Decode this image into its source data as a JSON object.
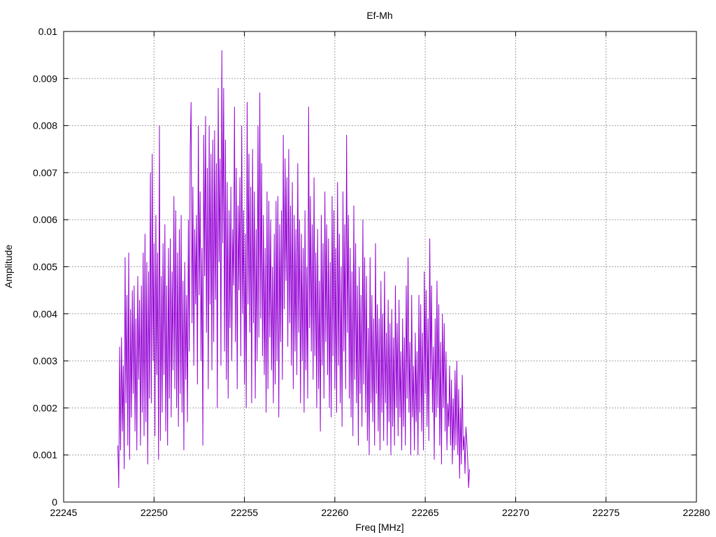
{
  "chart_data": {
    "type": "line",
    "title": "Ef-Mh",
    "xlabel": "Freq [MHz]",
    "ylabel": "Amplitude",
    "xlim": [
      22245,
      22280
    ],
    "ylim": [
      0,
      0.01
    ],
    "x_ticks": [
      22245,
      22250,
      22255,
      22260,
      22265,
      22270,
      22275,
      22280
    ],
    "x_tick_labels": [
      "22245",
      "22250",
      "22255",
      "22260",
      "22265",
      "22270",
      "22275",
      "22280"
    ],
    "y_ticks": [
      0,
      0.001,
      0.002,
      0.003,
      0.004,
      0.005,
      0.006,
      0.007,
      0.008,
      0.009,
      0.01
    ],
    "y_tick_labels": [
      "0",
      "0.001",
      "0.002",
      "0.003",
      "0.004",
      "0.005",
      "0.006",
      "0.007",
      "0.008",
      "0.009",
      "0.01"
    ],
    "grid": true,
    "series": [
      {
        "color": "#9400d3",
        "x_start": 22248.0,
        "x_step": 0.05,
        "values": [
          0.0012,
          0.0003,
          0.0033,
          0.0011,
          0.0035,
          0.0015,
          0.0029,
          0.0007,
          0.0052,
          0.0021,
          0.0044,
          0.0012,
          0.0053,
          0.0009,
          0.0041,
          0.0018,
          0.0045,
          0.0023,
          0.0046,
          0.0015,
          0.0039,
          0.0011,
          0.0048,
          0.0026,
          0.0043,
          0.0012,
          0.0046,
          0.0019,
          0.0053,
          0.0014,
          0.0057,
          0.0017,
          0.0051,
          0.0008,
          0.0049,
          0.0022,
          0.007,
          0.0021,
          0.0074,
          0.003,
          0.0055,
          0.0014,
          0.0061,
          0.0027,
          0.0053,
          0.0009,
          0.008,
          0.0013,
          0.0048,
          0.0019,
          0.0055,
          0.0027,
          0.0059,
          0.0015,
          0.0046,
          0.0012,
          0.0054,
          0.0022,
          0.0056,
          0.0018,
          0.0049,
          0.0028,
          0.0065,
          0.0024,
          0.0062,
          0.002,
          0.0053,
          0.0016,
          0.0058,
          0.0023,
          0.0061,
          0.0019,
          0.0047,
          0.0011,
          0.0051,
          0.0026,
          0.0044,
          0.0017,
          0.006,
          0.0032,
          0.0075,
          0.0085,
          0.0038,
          0.0067,
          0.0029,
          0.0058,
          0.0042,
          0.0061,
          0.0025,
          0.008,
          0.0044,
          0.0066,
          0.003,
          0.0054,
          0.0012,
          0.0078,
          0.0048,
          0.0082,
          0.0036,
          0.0071,
          0.0024,
          0.008,
          0.0042,
          0.0074,
          0.0028,
          0.0077,
          0.0034,
          0.0079,
          0.0043,
          0.0072,
          0.002,
          0.0088,
          0.0051,
          0.0073,
          0.0029,
          0.0096,
          0.0055,
          0.0088,
          0.0032,
          0.0077,
          0.0026,
          0.0068,
          0.0022,
          0.0062,
          0.0037,
          0.0067,
          0.003,
          0.0058,
          0.0046,
          0.0084,
          0.0034,
          0.0071,
          0.0024,
          0.0063,
          0.0045,
          0.0069,
          0.0031,
          0.008,
          0.004,
          0.0062,
          0.0025,
          0.0057,
          0.002,
          0.0085,
          0.0042,
          0.0074,
          0.0036,
          0.0067,
          0.0021,
          0.0075,
          0.0038,
          0.0066,
          0.0022,
          0.0058,
          0.003,
          0.008,
          0.0035,
          0.0087,
          0.0039,
          0.0072,
          0.0031,
          0.0061,
          0.0027,
          0.0054,
          0.0019,
          0.0066,
          0.0024,
          0.0064,
          0.0035,
          0.006,
          0.0028,
          0.005,
          0.0021,
          0.0057,
          0.0025,
          0.0064,
          0.003,
          0.0065,
          0.0018,
          0.0059,
          0.0034,
          0.0062,
          0.0026,
          0.0078,
          0.0041,
          0.0073,
          0.0047,
          0.0069,
          0.0033,
          0.0075,
          0.0038,
          0.0063,
          0.0029,
          0.0068,
          0.0024,
          0.0061,
          0.0032,
          0.0058,
          0.0027,
          0.0072,
          0.0036,
          0.006,
          0.0021,
          0.0057,
          0.003,
          0.0054,
          0.0019,
          0.0062,
          0.0028,
          0.005,
          0.0022,
          0.0084,
          0.0037,
          0.0065,
          0.0032,
          0.0059,
          0.0026,
          0.0069,
          0.0031,
          0.0053,
          0.002,
          0.0058,
          0.0024,
          0.0047,
          0.0015,
          0.0061,
          0.0029,
          0.0055,
          0.0022,
          0.0066,
          0.0034,
          0.0059,
          0.0027,
          0.0056,
          0.002,
          0.0051,
          0.0018,
          0.0065,
          0.0031,
          0.0062,
          0.0024,
          0.0054,
          0.0019,
          0.0068,
          0.0029,
          0.0057,
          0.0021,
          0.005,
          0.0016,
          0.0066,
          0.0032,
          0.0059,
          0.0024,
          0.0078,
          0.0036,
          0.0061,
          0.0022,
          0.0054,
          0.0018,
          0.0049,
          0.0014,
          0.0063,
          0.0026,
          0.0055,
          0.0021,
          0.0046,
          0.0012,
          0.005,
          0.0023,
          0.0044,
          0.0016,
          0.006,
          0.0025,
          0.0052,
          0.0019,
          0.0048,
          0.0013,
          0.0037,
          0.001,
          0.0052,
          0.0021,
          0.0044,
          0.0017,
          0.0039,
          0.0012,
          0.0055,
          0.0023,
          0.0042,
          0.0015,
          0.0039,
          0.0011,
          0.0047,
          0.0019,
          0.004,
          0.0013,
          0.0049,
          0.0021,
          0.0036,
          0.0012,
          0.0043,
          0.0017,
          0.0038,
          0.001,
          0.0041,
          0.0016,
          0.0035,
          0.0012,
          0.0046,
          0.002,
          0.0038,
          0.0014,
          0.0043,
          0.0018,
          0.0032,
          0.0011,
          0.0039,
          0.0016,
          0.0035,
          0.0012,
          0.0046,
          0.0022,
          0.0052,
          0.0019,
          0.0034,
          0.001,
          0.0044,
          0.0018,
          0.0029,
          0.0011,
          0.0036,
          0.0017,
          0.0032,
          0.001,
          0.0044,
          0.0019,
          0.0042,
          0.0015,
          0.0036,
          0.0011,
          0.0049,
          0.0023,
          0.0045,
          0.0016,
          0.0039,
          0.0013,
          0.0056,
          0.0026,
          0.0046,
          0.0019,
          0.0033,
          0.0009,
          0.0039,
          0.0018,
          0.0047,
          0.002,
          0.0042,
          0.0012,
          0.0034,
          0.0008,
          0.004,
          0.002,
          0.0038,
          0.0015,
          0.0032,
          0.0011,
          0.0021,
          0.0016,
          0.0029,
          0.0012,
          0.0026,
          0.0008,
          0.0022,
          0.0011,
          0.0028,
          0.0012,
          0.003,
          0.001,
          0.0024,
          0.0005,
          0.002,
          0.0008,
          0.0027,
          0.0011,
          0.0014,
          0.0006,
          0.0016,
          0.0013,
          0.0009,
          0.0003,
          0.0007
        ]
      }
    ]
  }
}
